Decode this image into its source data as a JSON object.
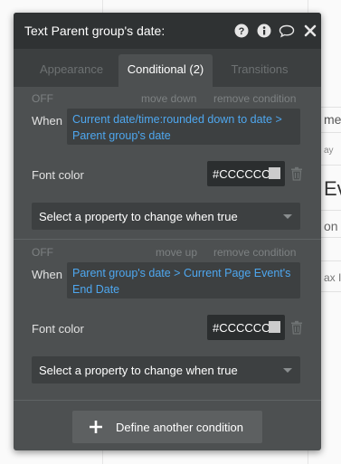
{
  "background": {
    "fragments": [
      "me",
      "ay",
      "Ev",
      "on",
      "ax In"
    ]
  },
  "panel": {
    "title": "Text Parent group's date:",
    "icons": [
      "help-icon",
      "info-icon",
      "comment-icon",
      "close-icon"
    ]
  },
  "tabs": [
    {
      "label": "Appearance",
      "active": false
    },
    {
      "label": "Conditional (2)",
      "active": true
    },
    {
      "label": "Transitions",
      "active": false
    }
  ],
  "conditions": [
    {
      "status": "OFF",
      "move_label": "move down",
      "remove_label": "remove condition",
      "when_label": "When",
      "expression": "Current date/time:rounded down to date > Parent group's date",
      "property_label": "Font color",
      "color_value": "#CCCCCC",
      "select_placeholder": "Select a property to change when true"
    },
    {
      "status": "OFF",
      "move_label": "move up",
      "remove_label": "remove condition",
      "when_label": "When",
      "expression": "Parent group's date > Current Page Event's End Date",
      "property_label": "Font color",
      "color_value": "#CCCCCC",
      "select_placeholder": "Select a property to change when true"
    }
  ],
  "footer": {
    "define_label": "Define another condition"
  },
  "colors": {
    "panel": "#4d5051",
    "titlebar": "#2f3233",
    "link": "#4ea7ef",
    "swatch": "#cccccc"
  }
}
